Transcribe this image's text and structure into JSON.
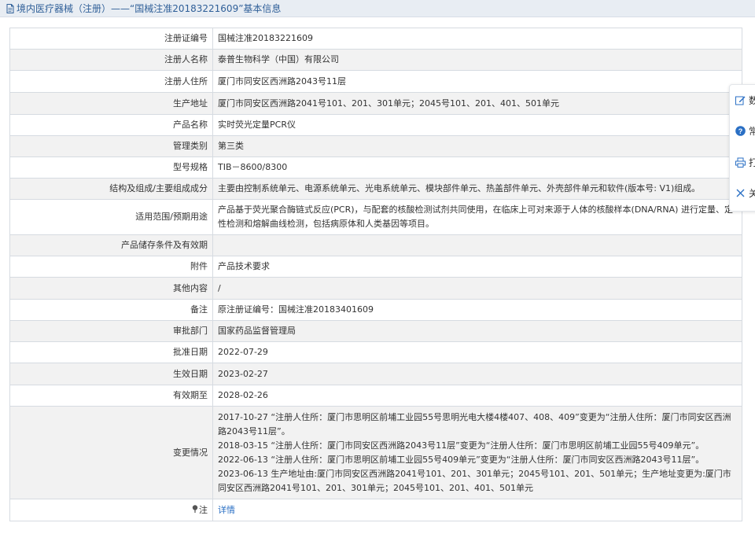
{
  "header": {
    "title": "境内医疗器械（注册）——“国械注准20183221609”基本信息"
  },
  "rows": [
    {
      "label": "注册证编号",
      "value": "国械注准20183221609"
    },
    {
      "label": "注册人名称",
      "value": "泰普生物科学（中国）有限公司"
    },
    {
      "label": "注册人住所",
      "value": "厦门市同安区西洲路2043号11层"
    },
    {
      "label": "生产地址",
      "value": "厦门市同安区西洲路2041号101、201、301单元；2045号101、201、401、501单元"
    },
    {
      "label": "产品名称",
      "value": "实时荧光定量PCR仪"
    },
    {
      "label": "管理类别",
      "value": "第三类"
    },
    {
      "label": "型号规格",
      "value": "TIB－8600/8300"
    },
    {
      "label": "结构及组成/主要组成成分",
      "value": "主要由控制系统单元、电源系统单元、光电系统单元、模块部件单元、热盖部件单元、外壳部件单元和软件(版本号: V1)组成。"
    },
    {
      "label": "适用范围/预期用途",
      "value": "产品基于荧光聚合酶链式反应(PCR)，与配套的核酸检测试剂共同使用，在临床上可对来源于人体的核酸样本(DNA/RNA) 进行定量、定性检测和熔解曲线检测，包括病原体和人类基因等项目。"
    },
    {
      "label": "产品储存条件及有效期",
      "value": ""
    },
    {
      "label": "附件",
      "value": "产品技术要求"
    },
    {
      "label": "其他内容",
      "value": "/"
    },
    {
      "label": "备注",
      "value": "原注册证编号：国械注准20183401609"
    },
    {
      "label": "审批部门",
      "value": "国家药品监督管理局"
    },
    {
      "label": "批准日期",
      "value": "2022-07-29"
    },
    {
      "label": "生效日期",
      "value": "2023-02-27"
    },
    {
      "label": "有效期至",
      "value": "2028-02-26"
    }
  ],
  "change_row": {
    "label": "变更情况",
    "lines": [
      "2017-10-27 “注册人住所：厦门市思明区前埔工业园55号思明光电大楼4楼407、408、409”变更为“注册人住所：厦门市同安区西洲路2043号11层”。",
      "2018-03-15 “注册人住所：厦门市同安区西洲路2043号11层”变更为“注册人住所：厦门市思明区前埔工业园55号409单元”。",
      "2022-06-13 “注册人住所：厦门市思明区前埔工业园55号409单元”变更为“注册人住所：厦门市同安区西洲路2043号11层”。",
      "2023-06-13 生产地址由:厦门市同安区西洲路2041号101、201、301单元；2045号101、201、501单元；生产地址变更为:厦门市同安区西洲路2041号101、201、301单元；2045号101、201、401、501单元"
    ]
  },
  "note_row": {
    "label": "注",
    "link": "详情"
  },
  "float_panel": {
    "items": [
      {
        "icon": "edit-icon",
        "label": "数"
      },
      {
        "icon": "help-icon",
        "label": "常"
      },
      {
        "icon": "print-icon",
        "label": "打"
      },
      {
        "icon": "close-icon",
        "label": "关"
      }
    ]
  }
}
